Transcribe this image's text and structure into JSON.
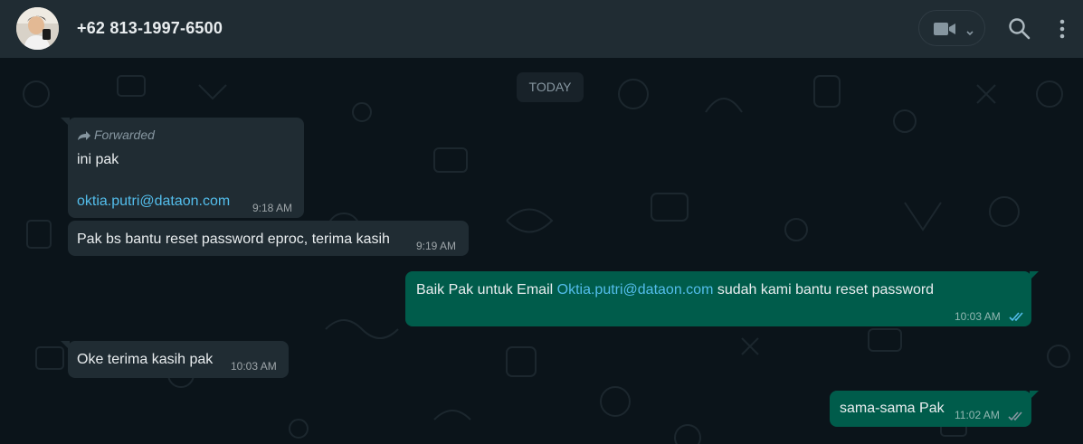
{
  "header": {
    "contact_name": "+62 813-1997-6500",
    "icons": [
      "avatar",
      "video-call-icon",
      "chevron-down-icon",
      "search-icon",
      "menu-icon"
    ]
  },
  "chat": {
    "date_divider": "TODAY",
    "messages": [
      {
        "direction": "incoming",
        "forwarded_label": "Forwarded",
        "line1": "ini pak",
        "link": "oktia.putri@dataon.com",
        "time": "9:18 AM"
      },
      {
        "direction": "incoming",
        "text": "Pak bs bantu reset password eproc, terima kasih",
        "time": "9:19 AM"
      },
      {
        "direction": "outgoing",
        "text_before": "Baik Pak untuk Email ",
        "link": "Oktia.putri@dataon.com",
        "text_after": " sudah kami bantu reset password",
        "time": "10:03 AM",
        "status": "read"
      },
      {
        "direction": "incoming",
        "text": "Oke terima kasih pak",
        "time": "10:03 AM"
      },
      {
        "direction": "outgoing",
        "text": "sama-sama Pak",
        "time": "11:02 AM",
        "status": "delivered"
      }
    ]
  },
  "colors": {
    "header_bg": "#202c33",
    "chat_bg": "#0b141a",
    "incoming_bubble": "#202c33",
    "outgoing_bubble": "#005c4b",
    "link": "#53bdeb",
    "read_ticks": "#53bdeb"
  }
}
